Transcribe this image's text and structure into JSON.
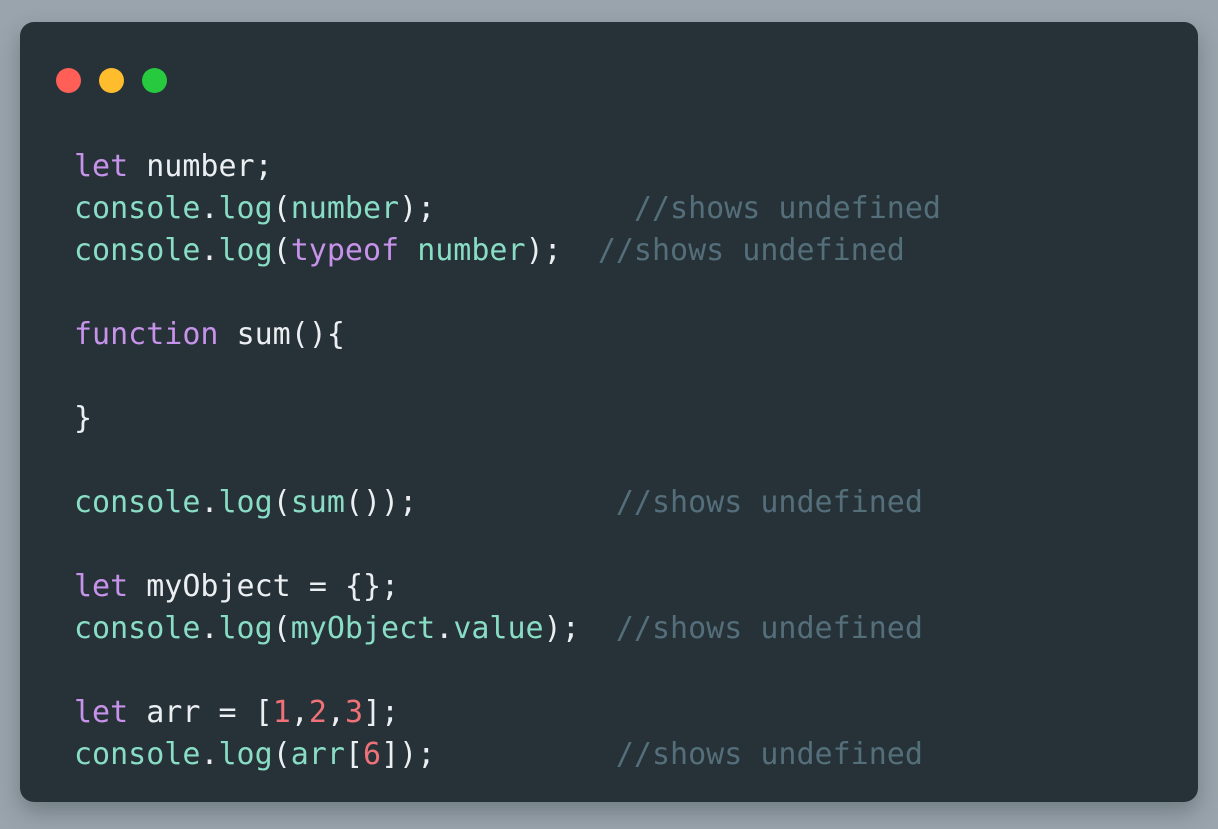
{
  "window": {
    "name": "code-snippet-window",
    "background_color": "#263238",
    "page_background_color": "#99a4ac",
    "traffic_lights": [
      {
        "name": "close",
        "color": "#ff5f56"
      },
      {
        "name": "minimize",
        "color": "#ffbd2e"
      },
      {
        "name": "maximize",
        "color": "#27c93f"
      }
    ]
  },
  "theme": {
    "keyword_color": "#c792ea",
    "identifier_color": "#89ddc4",
    "punctuation_color": "#eceff1",
    "number_color": "#f07178",
    "comment_color": "#546e7a"
  },
  "code": {
    "language": "javascript",
    "lines": [
      {
        "index": 1,
        "text": "let number;",
        "tokens": [
          {
            "t": "let",
            "c": "keyword"
          },
          {
            "t": " ",
            "c": "plain"
          },
          {
            "t": "number",
            "c": "plain"
          },
          {
            "t": ";",
            "c": "punct"
          }
        ]
      },
      {
        "index": 2,
        "text": "console.log(number);           //shows undefined",
        "tokens": [
          {
            "t": "console",
            "c": "ident"
          },
          {
            "t": ".",
            "c": "punct"
          },
          {
            "t": "log",
            "c": "ident"
          },
          {
            "t": "(",
            "c": "punct"
          },
          {
            "t": "number",
            "c": "ident"
          },
          {
            "t": ")",
            "c": "punct"
          },
          {
            "t": ";",
            "c": "punct"
          },
          {
            "t": "           ",
            "c": "plain"
          },
          {
            "t": "//shows undefined",
            "c": "comment"
          }
        ]
      },
      {
        "index": 3,
        "text": "console.log(typeof number);  //shows undefined",
        "tokens": [
          {
            "t": "console",
            "c": "ident"
          },
          {
            "t": ".",
            "c": "punct"
          },
          {
            "t": "log",
            "c": "ident"
          },
          {
            "t": "(",
            "c": "punct"
          },
          {
            "t": "typeof",
            "c": "keyword"
          },
          {
            "t": " ",
            "c": "plain"
          },
          {
            "t": "number",
            "c": "ident"
          },
          {
            "t": ")",
            "c": "punct"
          },
          {
            "t": ";",
            "c": "punct"
          },
          {
            "t": "  ",
            "c": "plain"
          },
          {
            "t": "//shows undefined",
            "c": "comment"
          }
        ]
      },
      {
        "index": 4,
        "text": "",
        "tokens": []
      },
      {
        "index": 5,
        "text": "function sum(){",
        "tokens": [
          {
            "t": "function",
            "c": "keyword"
          },
          {
            "t": " ",
            "c": "plain"
          },
          {
            "t": "sum",
            "c": "plain"
          },
          {
            "t": "(){",
            "c": "punct"
          }
        ]
      },
      {
        "index": 6,
        "text": "",
        "tokens": []
      },
      {
        "index": 7,
        "text": "}",
        "tokens": [
          {
            "t": "}",
            "c": "punct"
          }
        ]
      },
      {
        "index": 8,
        "text": "",
        "tokens": []
      },
      {
        "index": 9,
        "text": "console.log(sum());           //shows undefined",
        "tokens": [
          {
            "t": "console",
            "c": "ident"
          },
          {
            "t": ".",
            "c": "punct"
          },
          {
            "t": "log",
            "c": "ident"
          },
          {
            "t": "(",
            "c": "punct"
          },
          {
            "t": "sum",
            "c": "ident"
          },
          {
            "t": "());",
            "c": "punct"
          },
          {
            "t": "           ",
            "c": "plain"
          },
          {
            "t": "//shows undefined",
            "c": "comment"
          }
        ]
      },
      {
        "index": 10,
        "text": "",
        "tokens": []
      },
      {
        "index": 11,
        "text": "let myObject = {};",
        "tokens": [
          {
            "t": "let",
            "c": "keyword"
          },
          {
            "t": " ",
            "c": "plain"
          },
          {
            "t": "myObject",
            "c": "plain"
          },
          {
            "t": " ",
            "c": "plain"
          },
          {
            "t": "=",
            "c": "punct"
          },
          {
            "t": " ",
            "c": "plain"
          },
          {
            "t": "{};",
            "c": "punct"
          }
        ]
      },
      {
        "index": 12,
        "text": "console.log(myObject.value);  //shows undefined",
        "tokens": [
          {
            "t": "console",
            "c": "ident"
          },
          {
            "t": ".",
            "c": "punct"
          },
          {
            "t": "log",
            "c": "ident"
          },
          {
            "t": "(",
            "c": "punct"
          },
          {
            "t": "myObject",
            "c": "ident"
          },
          {
            "t": ".",
            "c": "punct"
          },
          {
            "t": "value",
            "c": "ident"
          },
          {
            "t": ")",
            "c": "punct"
          },
          {
            "t": ";",
            "c": "punct"
          },
          {
            "t": "  ",
            "c": "plain"
          },
          {
            "t": "//shows undefined",
            "c": "comment"
          }
        ]
      },
      {
        "index": 13,
        "text": "",
        "tokens": []
      },
      {
        "index": 14,
        "text": "let arr = [1,2,3];",
        "tokens": [
          {
            "t": "let",
            "c": "keyword"
          },
          {
            "t": " ",
            "c": "plain"
          },
          {
            "t": "arr",
            "c": "plain"
          },
          {
            "t": " ",
            "c": "plain"
          },
          {
            "t": "=",
            "c": "punct"
          },
          {
            "t": " ",
            "c": "plain"
          },
          {
            "t": "[",
            "c": "punct"
          },
          {
            "t": "1",
            "c": "number"
          },
          {
            "t": ",",
            "c": "punct"
          },
          {
            "t": "2",
            "c": "number"
          },
          {
            "t": ",",
            "c": "punct"
          },
          {
            "t": "3",
            "c": "number"
          },
          {
            "t": "];",
            "c": "punct"
          }
        ]
      },
      {
        "index": 15,
        "text": "console.log(arr[6]);          //shows undefined",
        "tokens": [
          {
            "t": "console",
            "c": "ident"
          },
          {
            "t": ".",
            "c": "punct"
          },
          {
            "t": "log",
            "c": "ident"
          },
          {
            "t": "(",
            "c": "punct"
          },
          {
            "t": "arr",
            "c": "ident"
          },
          {
            "t": "[",
            "c": "punct"
          },
          {
            "t": "6",
            "c": "number"
          },
          {
            "t": "]",
            "c": "punct"
          },
          {
            "t": ")",
            "c": "punct"
          },
          {
            "t": ";",
            "c": "punct"
          },
          {
            "t": "          ",
            "c": "plain"
          },
          {
            "t": "//shows undefined",
            "c": "comment"
          }
        ]
      }
    ]
  }
}
